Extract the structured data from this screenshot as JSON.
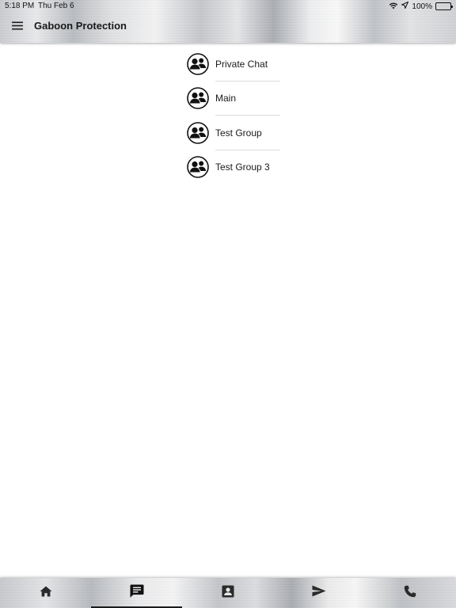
{
  "status_bar": {
    "time": "5:18 PM",
    "date": "Thu Feb 6",
    "battery_percent": "100%",
    "battery_level": 1.0,
    "icons": [
      "wifi-icon",
      "location-arrow-icon",
      "battery-icon"
    ]
  },
  "app": {
    "title": "Gaboon Protection",
    "menu_icon": "hamburger-menu-icon"
  },
  "chats": [
    {
      "label": "Private Chat",
      "icon": "group-avatar-icon"
    },
    {
      "label": "Main",
      "icon": "group-avatar-icon"
    },
    {
      "label": "Test Group",
      "icon": "group-avatar-icon"
    },
    {
      "label": "Test Group 3",
      "icon": "group-avatar-icon"
    }
  ],
  "tabs": [
    {
      "name": "home",
      "icon": "home-icon",
      "active": false
    },
    {
      "name": "chat",
      "icon": "chat-icon",
      "active": true
    },
    {
      "name": "contacts",
      "icon": "contact-card-icon",
      "active": false
    },
    {
      "name": "send",
      "icon": "send-icon",
      "active": false
    },
    {
      "name": "phone",
      "icon": "phone-icon",
      "active": false
    }
  ],
  "colors": {
    "text": "#1a1a1a",
    "divider": "#dcdcdc",
    "background": "#ffffff"
  }
}
